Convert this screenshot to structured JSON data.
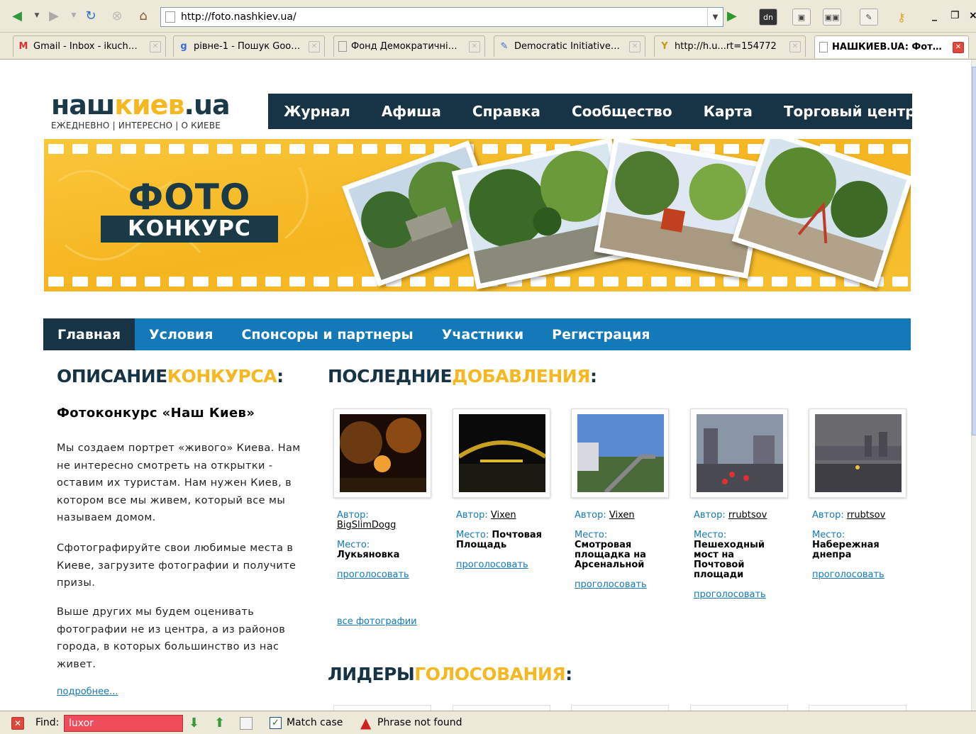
{
  "browser": {
    "url": "http://foto.nashkiev.ua/",
    "tabs": [
      {
        "label": "Gmail - Inbox - ikuch…",
        "icon": "gmail-icon",
        "active": false
      },
      {
        "label": "рівне-1 - Пошук Goo…",
        "icon": "google-icon",
        "active": false
      },
      {
        "label": "Фонд Демократичні…",
        "icon": "page-icon",
        "active": false
      },
      {
        "label": "Democratic Initiative…",
        "icon": "document-icon",
        "active": false
      },
      {
        "label": "http://h.u...rt=154772",
        "icon": "yahoo-icon",
        "active": false
      },
      {
        "label": "НАШКИЕВ.UA: Фот…",
        "icon": "page-icon",
        "active": true
      }
    ]
  },
  "site": {
    "logo_part1": "наш",
    "logo_part2": "киев",
    "logo_part3": ".ua",
    "tagline": "ЕЖЕДНЕВНО | ИНТЕРЕСНО | О КИЕВЕ",
    "main_nav": [
      "Журнал",
      "Афиша",
      "Справка",
      "Сообщество",
      "Карта",
      "Торговый центр"
    ],
    "banner_title_big": "ФОТО",
    "banner_title_small": "КОНКУРС",
    "sub_nav": [
      "Главная",
      "Условия",
      "Спонсоры и партнеры",
      "Участники",
      "Регистрация"
    ],
    "sub_nav_active": 0
  },
  "description": {
    "title_dark": "ОПИСАНИЕ",
    "title_yellow": "КОНКУРСА",
    "title_colon": ":",
    "contest_name": "Фотоконкурс «Наш Киев»",
    "paragraphs": [
      "Мы создаем портрет «живого» Киева. Нам не интересно смотреть на открытки - оставим их туристам. Нам нужен Киев, в котором все мы живем, который все мы называем домом.",
      "Сфотографируйте свои любимые места в Киеве, загрузите фотографии и получите призы.",
      "Выше других мы будем оценивать фотографии не из центра, а из районов города, в которых большинство из нас живет."
    ],
    "more_link": "подробнее..."
  },
  "recent": {
    "title_dark": "ПОСЛЕДНИЕ",
    "title_yellow": "ДОБАВЛЕНИЯ",
    "title_colon": ":",
    "author_label": "Автор:",
    "place_label": "Место:",
    "vote_label": "проголосовать",
    "items": [
      {
        "author": "BigSlimDogg",
        "place": "Лукьяновка"
      },
      {
        "author": "Vixen",
        "place": "Почтовая Площадь"
      },
      {
        "author": "Vixen",
        "place": "Смотровая площадка на Арсенальной"
      },
      {
        "author": "rrubtsov",
        "place": "Пешеходный мост на Почтовой площади"
      },
      {
        "author": "rrubtsov",
        "place": "Набережная днепра"
      }
    ],
    "all_photos": "все фотографии"
  },
  "leaders": {
    "title_dark": "ЛИДЕРЫ",
    "title_yellow": "ГОЛОСОВАНИЯ",
    "title_colon": ":"
  },
  "findbar": {
    "label": "Find:",
    "value": "luxor",
    "match_case": "Match case",
    "status": "Phrase not found"
  },
  "colors": {
    "dark_navy": "#173447",
    "blue": "#1479b8",
    "yellow": "#f5b820"
  }
}
